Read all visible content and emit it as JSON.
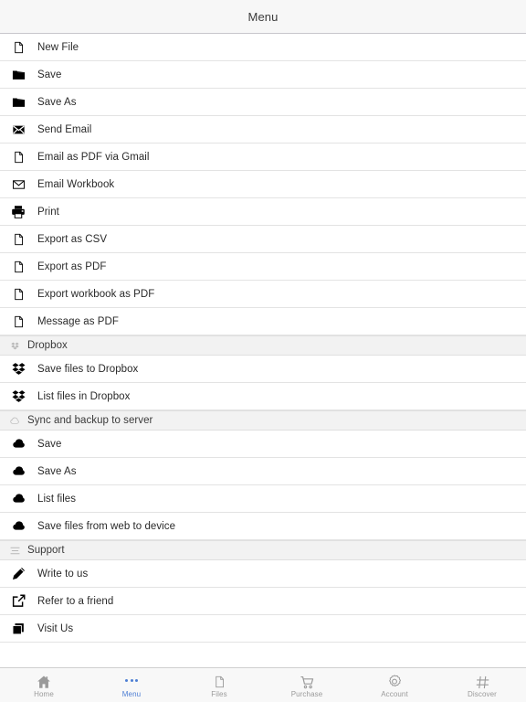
{
  "navbar": {
    "title": "Menu"
  },
  "colors": {
    "accent": "#4e7fd4",
    "tab_inactive": "#9a9a9a",
    "navbar_bg": "#f7f7f7",
    "section_bg": "#f2f2f2",
    "row_text": "#2a2a2a",
    "separator": "#e3e3e3",
    "icon": "#000000"
  },
  "list": [
    {
      "kind": "row",
      "icon": "file-icon",
      "label": "New File"
    },
    {
      "kind": "row",
      "icon": "folder-icon",
      "label": "Save"
    },
    {
      "kind": "row",
      "icon": "folder-icon",
      "label": "Save As"
    },
    {
      "kind": "row",
      "icon": "envelope-filled-icon",
      "label": "Send Email"
    },
    {
      "kind": "row",
      "icon": "file-icon",
      "label": "Email as PDF via Gmail"
    },
    {
      "kind": "row",
      "icon": "envelope-outline-icon",
      "label": "Email Workbook"
    },
    {
      "kind": "row",
      "icon": "printer-icon",
      "label": "Print"
    },
    {
      "kind": "row",
      "icon": "file-icon",
      "label": "Export as CSV"
    },
    {
      "kind": "row",
      "icon": "file-icon",
      "label": "Export as PDF"
    },
    {
      "kind": "row",
      "icon": "file-icon",
      "label": "Export workbook as PDF"
    },
    {
      "kind": "row",
      "icon": "file-icon",
      "label": "Message as PDF"
    },
    {
      "kind": "section",
      "icon": "dropbox-small-icon",
      "label": "Dropbox"
    },
    {
      "kind": "row",
      "icon": "dropbox-icon",
      "label": "Save files to Dropbox"
    },
    {
      "kind": "row",
      "icon": "dropbox-icon",
      "label": "List files in Dropbox"
    },
    {
      "kind": "section",
      "icon": "cloud-outline-icon",
      "label": "Sync and backup to server"
    },
    {
      "kind": "row",
      "icon": "cloud-filled-icon",
      "label": "Save"
    },
    {
      "kind": "row",
      "icon": "cloud-filled-icon",
      "label": "Save As"
    },
    {
      "kind": "row",
      "icon": "cloud-filled-icon",
      "label": "List files"
    },
    {
      "kind": "row",
      "icon": "cloud-filled-icon",
      "label": "Save files from web to device"
    },
    {
      "kind": "section",
      "icon": "lines-icon",
      "label": "Support"
    },
    {
      "kind": "row",
      "icon": "pencil-icon",
      "label": "Write to us"
    },
    {
      "kind": "row",
      "icon": "share-icon",
      "label": "Refer to a friend"
    },
    {
      "kind": "row",
      "icon": "stacked-squares-icon",
      "label": "Visit Us"
    }
  ],
  "tabbar": [
    {
      "icon": "home-icon",
      "label": "Home",
      "active": false
    },
    {
      "icon": "dots-icon",
      "label": "Menu",
      "active": true
    },
    {
      "icon": "file-icon",
      "label": "Files",
      "active": false
    },
    {
      "icon": "cart-icon",
      "label": "Purchase",
      "active": false
    },
    {
      "icon": "gear-icon",
      "label": "Account",
      "active": false
    },
    {
      "icon": "hash-icon",
      "label": "Discover",
      "active": false
    }
  ]
}
